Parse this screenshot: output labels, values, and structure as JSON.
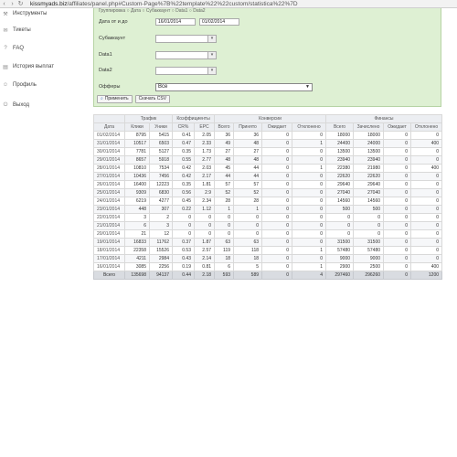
{
  "browser": {
    "back_icon": "left-arrow-icon",
    "forward_icon": "right-arrow-icon",
    "reload_icon": "reload-icon",
    "url_host": "kissmyads.biz",
    "url_path": "/affiliates/panel.php#Custom-Page%7B%22template%22%22custom/statistica%22%7D"
  },
  "sidebar": {
    "items": [
      {
        "label": "Инструменты",
        "icon": "tools-icon"
      },
      {
        "label": "Тикеты",
        "icon": "tickets-icon"
      },
      {
        "label": "FAQ",
        "icon": "faq-icon"
      },
      {
        "label": "История выплат",
        "icon": "payments-icon"
      },
      {
        "label": "Профиль",
        "icon": "profile-icon"
      },
      {
        "label": "Выход",
        "icon": "logout-icon"
      }
    ]
  },
  "filters": {
    "top_cut_text": "Группировка   ○ Дата  ○ Субаккаунт  ○ Data1  ○ Data2",
    "date_label": "Дата от и до",
    "date_from": "16/01/2014",
    "date_to": "01/02/2014",
    "subaccount_label": "Субаккаунт",
    "data1_label": "Data1",
    "data2_label": "Data2",
    "offers_label": "Офферы",
    "offers_value": "Все",
    "apply_label": "Применить",
    "csv_label": "Скачать CSV"
  },
  "table": {
    "groups": [
      "Трафик",
      "Коэффициенты",
      "Конверсии",
      "Финансы"
    ],
    "columns": [
      "Дата",
      "Клики",
      "Уники",
      "CR%",
      "EPC",
      "Всего",
      "Принято",
      "Ожидает",
      "Отклонено",
      "Всего",
      "Зачислено",
      "Ожидает",
      "Отклонено"
    ],
    "rows": [
      [
        "01/02/2014",
        "8795",
        "5415",
        "0.41",
        "2.05",
        "36",
        "36",
        "0",
        "0",
        "18000",
        "18000",
        "0",
        "0"
      ],
      [
        "31/01/2014",
        "10517",
        "6503",
        "0.47",
        "2.33",
        "49",
        "48",
        "0",
        "1",
        "24400",
        "24000",
        "0",
        "400"
      ],
      [
        "30/01/2014",
        "7781",
        "5127",
        "0.35",
        "1.73",
        "27",
        "27",
        "0",
        "0",
        "13500",
        "13500",
        "0",
        "0"
      ],
      [
        "29/01/2014",
        "8657",
        "5918",
        "0.55",
        "2.77",
        "48",
        "48",
        "0",
        "0",
        "23940",
        "23940",
        "0",
        "0"
      ],
      [
        "28/01/2014",
        "10810",
        "7534",
        "0.42",
        "2.03",
        "45",
        "44",
        "0",
        "1",
        "22380",
        "21980",
        "0",
        "400"
      ],
      [
        "27/01/2014",
        "10436",
        "7456",
        "0.42",
        "2.17",
        "44",
        "44",
        "0",
        "0",
        "22620",
        "22620",
        "0",
        "0"
      ],
      [
        "26/01/2014",
        "16400",
        "12223",
        "0.35",
        "1.81",
        "57",
        "57",
        "0",
        "0",
        "29640",
        "29640",
        "0",
        "0"
      ],
      [
        "25/01/2014",
        "9309",
        "6830",
        "0.56",
        "2.9",
        "52",
        "52",
        "0",
        "0",
        "27040",
        "27040",
        "0",
        "0"
      ],
      [
        "24/01/2014",
        "6219",
        "4277",
        "0.45",
        "2.34",
        "28",
        "28",
        "0",
        "0",
        "14560",
        "14560",
        "0",
        "0"
      ],
      [
        "23/01/2014",
        "448",
        "307",
        "0.22",
        "1.12",
        "1",
        "1",
        "0",
        "0",
        "500",
        "500",
        "0",
        "0"
      ],
      [
        "22/01/2014",
        "3",
        "2",
        "0",
        "0",
        "0",
        "0",
        "0",
        "0",
        "0",
        "0",
        "0",
        "0"
      ],
      [
        "21/01/2014",
        "6",
        "3",
        "0",
        "0",
        "0",
        "0",
        "0",
        "0",
        "0",
        "0",
        "0",
        "0"
      ],
      [
        "20/01/2014",
        "21",
        "12",
        "0",
        "0",
        "0",
        "0",
        "0",
        "0",
        "0",
        "0",
        "0",
        "0"
      ],
      [
        "19/01/2014",
        "16833",
        "11762",
        "0.37",
        "1.87",
        "63",
        "63",
        "0",
        "0",
        "31500",
        "31500",
        "0",
        "0"
      ],
      [
        "18/01/2014",
        "22358",
        "15526",
        "0.53",
        "2.57",
        "119",
        "118",
        "0",
        "1",
        "57480",
        "57480",
        "0",
        "0"
      ],
      [
        "17/01/2014",
        "4211",
        "2984",
        "0.43",
        "2.14",
        "18",
        "18",
        "0",
        "0",
        "9000",
        "9000",
        "0",
        "0"
      ],
      [
        "16/01/2014",
        "3085",
        "2256",
        "0.19",
        "0.81",
        "6",
        "5",
        "0",
        "1",
        "2900",
        "2500",
        "0",
        "400"
      ]
    ],
    "totals": [
      "Всего",
      "135698",
      "94137",
      "0.44",
      "2.18",
      "593",
      "589",
      "0",
      "4",
      "297460",
      "296260",
      "0",
      "1200"
    ]
  }
}
